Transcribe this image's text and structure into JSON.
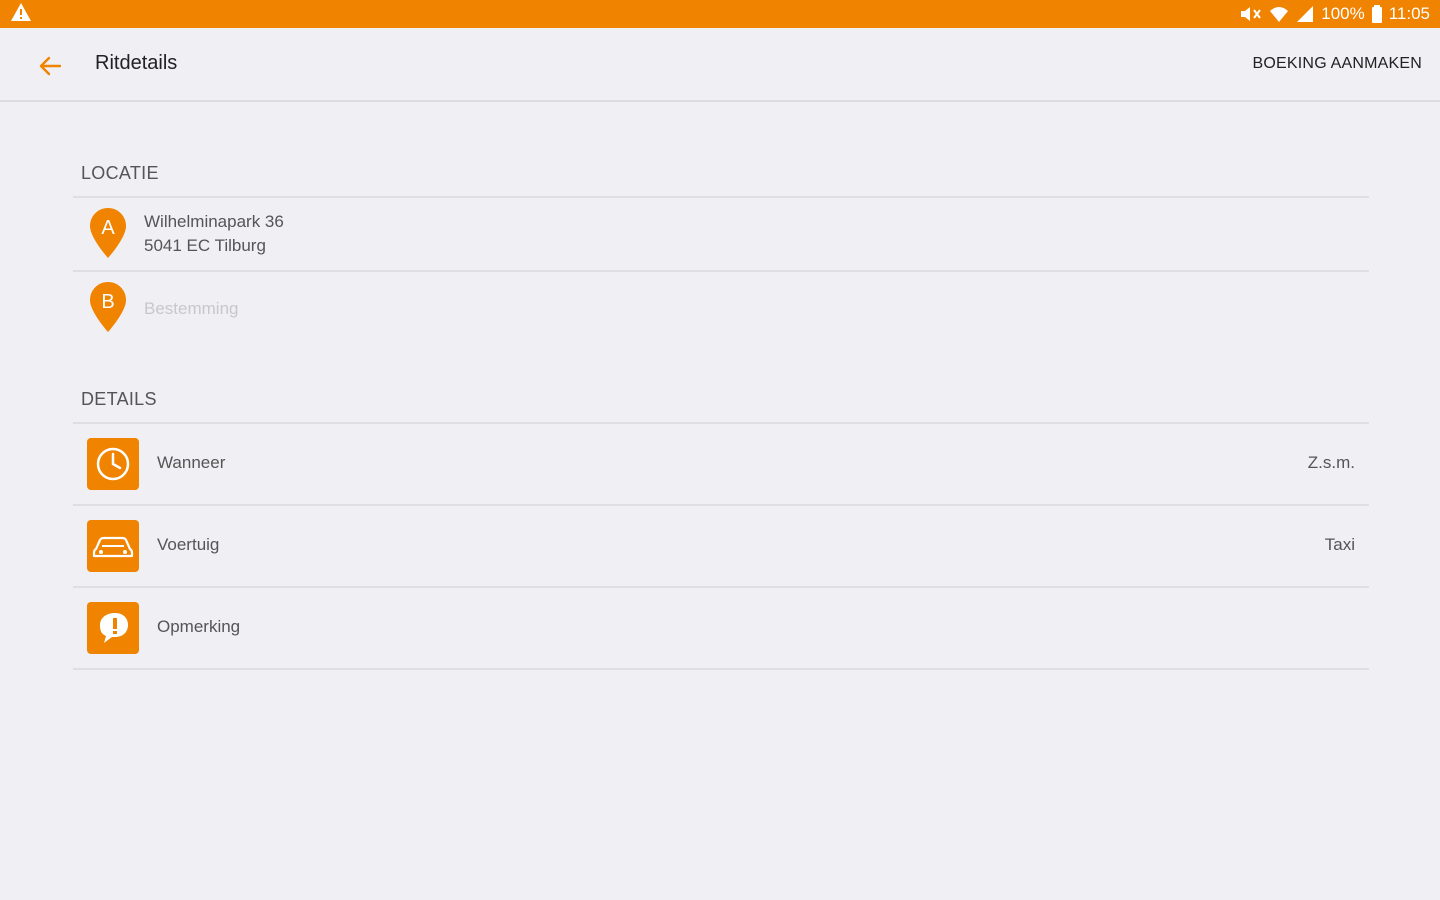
{
  "status_bar": {
    "battery": "100%",
    "time": "11:05",
    "color": "#f08300"
  },
  "app_bar": {
    "title": "Ritdetails",
    "action": "BOEKING AANMAKEN"
  },
  "location": {
    "header": "LOCATIE",
    "pickup": {
      "marker": "A",
      "line1": "Wilhelminapark 36",
      "line2": "5041 EC Tilburg"
    },
    "destination": {
      "marker": "B",
      "placeholder": "Bestemming"
    }
  },
  "details": {
    "header": "DETAILS",
    "items": [
      {
        "icon": "clock-icon",
        "label": "Wanneer",
        "value": "Z.s.m."
      },
      {
        "icon": "car-icon",
        "label": "Voertuig",
        "value": "Taxi"
      },
      {
        "icon": "comment-icon",
        "label": "Opmerking",
        "value": ""
      }
    ]
  },
  "accent_color": "#f08300"
}
